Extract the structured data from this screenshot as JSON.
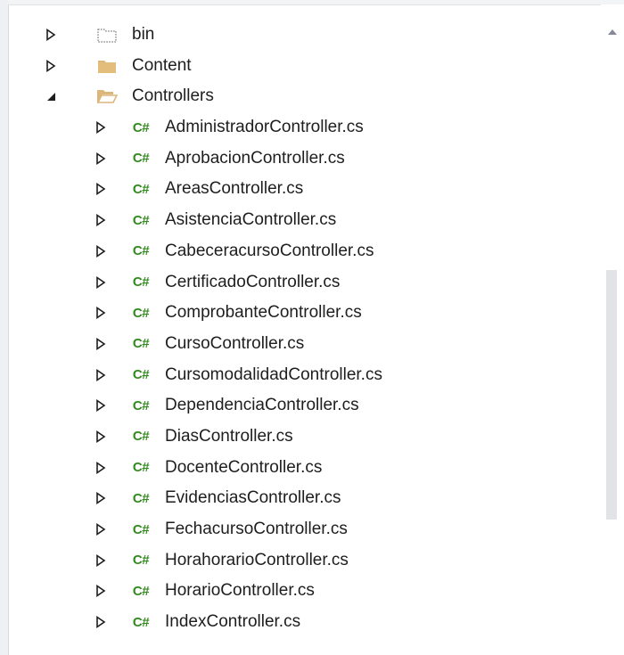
{
  "tree": {
    "items": [
      {
        "label": "bin",
        "icon": "folder-dotted-icon",
        "expanded": false,
        "level": 0
      },
      {
        "label": "Content",
        "icon": "folder-icon",
        "expanded": false,
        "level": 0
      },
      {
        "label": "Controllers",
        "icon": "folder-open-icon",
        "expanded": true,
        "level": 0
      },
      {
        "label": "AdministradorController.cs",
        "icon": "csharp-file-icon",
        "expanded": false,
        "level": 1
      },
      {
        "label": "AprobacionController.cs",
        "icon": "csharp-file-icon",
        "expanded": false,
        "level": 1
      },
      {
        "label": "AreasController.cs",
        "icon": "csharp-file-icon",
        "expanded": false,
        "level": 1
      },
      {
        "label": "AsistenciaController.cs",
        "icon": "csharp-file-icon",
        "expanded": false,
        "level": 1
      },
      {
        "label": "CabeceracursoController.cs",
        "icon": "csharp-file-icon",
        "expanded": false,
        "level": 1
      },
      {
        "label": "CertificadoController.cs",
        "icon": "csharp-file-icon",
        "expanded": false,
        "level": 1
      },
      {
        "label": "ComprobanteController.cs",
        "icon": "csharp-file-icon",
        "expanded": false,
        "level": 1
      },
      {
        "label": "CursoController.cs",
        "icon": "csharp-file-icon",
        "expanded": false,
        "level": 1
      },
      {
        "label": "CursomodalidadController.cs",
        "icon": "csharp-file-icon",
        "expanded": false,
        "level": 1
      },
      {
        "label": "DependenciaController.cs",
        "icon": "csharp-file-icon",
        "expanded": false,
        "level": 1
      },
      {
        "label": "DiasController.cs",
        "icon": "csharp-file-icon",
        "expanded": false,
        "level": 1
      },
      {
        "label": "DocenteController.cs",
        "icon": "csharp-file-icon",
        "expanded": false,
        "level": 1
      },
      {
        "label": "EvidenciasController.cs",
        "icon": "csharp-file-icon",
        "expanded": false,
        "level": 1
      },
      {
        "label": "FechacursoController.cs",
        "icon": "csharp-file-icon",
        "expanded": false,
        "level": 1
      },
      {
        "label": "HorahorarioController.cs",
        "icon": "csharp-file-icon",
        "expanded": false,
        "level": 1
      },
      {
        "label": "HorarioController.cs",
        "icon": "csharp-file-icon",
        "expanded": false,
        "level": 1
      },
      {
        "label": "IndexController.cs",
        "icon": "csharp-file-icon",
        "expanded": false,
        "level": 1
      }
    ],
    "csharp_badge": "C#"
  },
  "colors": {
    "csharp_badge": "#338a1f",
    "folder": "#dcb67a",
    "text": "#1e1e1e"
  }
}
